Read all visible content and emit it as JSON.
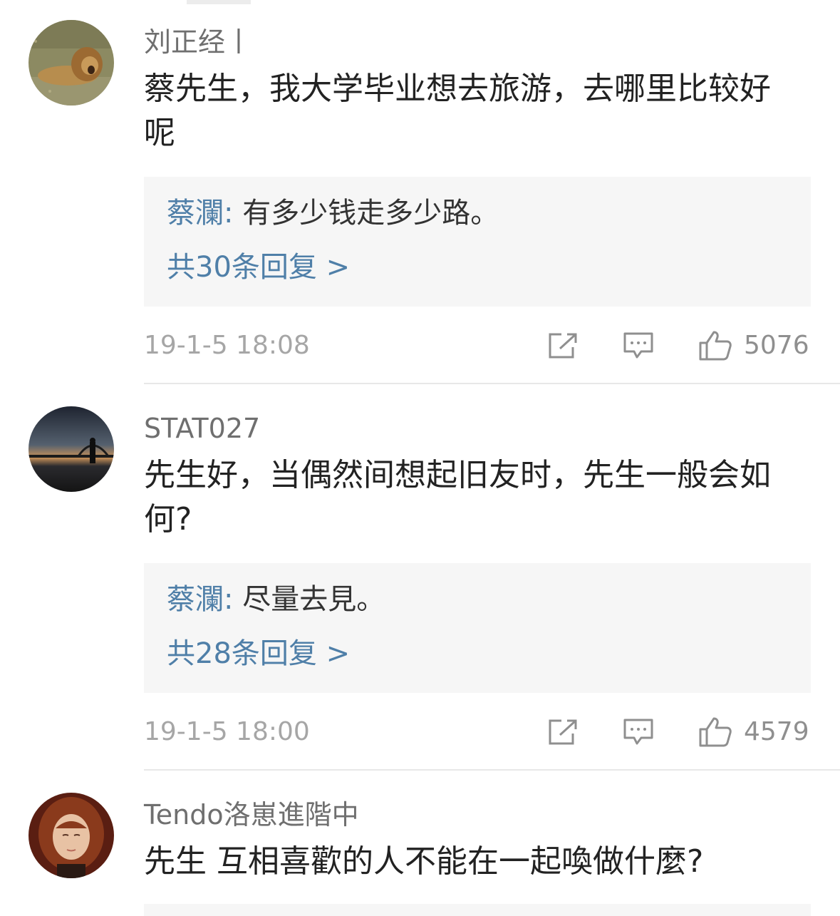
{
  "comments": [
    {
      "username": "刘正经丨",
      "avatar_icon": "lion-avatar",
      "text": "蔡先生，我大学毕业想去旅游，去哪里比较好呢",
      "reply": {
        "author": "蔡瀾",
        "separator": ":",
        "text": "有多少钱走多少路。",
        "more": "共30条回复 >"
      },
      "timestamp": "19-1-5 18:08",
      "likes": "5076"
    },
    {
      "username": "STAT027",
      "avatar_icon": "harbour-sunset-avatar",
      "text": "先生好，当偶然间想起旧友时，先生一般会如何?",
      "reply": {
        "author": "蔡瀾",
        "separator": ":",
        "text": "尽量去見。",
        "more": "共28条回复 >"
      },
      "timestamp": "19-1-5 18:00",
      "likes": "4579"
    },
    {
      "username": "Tendo洛崽進階中",
      "avatar_icon": "portrait-avatar",
      "text": "先生 互相喜歡的人不能在一起喚做什麼?"
    }
  ],
  "colors": {
    "link_blue": "#4f7fa8",
    "meta_gray": "#a6a6a6",
    "reply_bg": "#f6f6f6"
  },
  "icons": {
    "share": "share-icon",
    "comment": "comment-icon",
    "like": "thumbs-up-icon"
  }
}
